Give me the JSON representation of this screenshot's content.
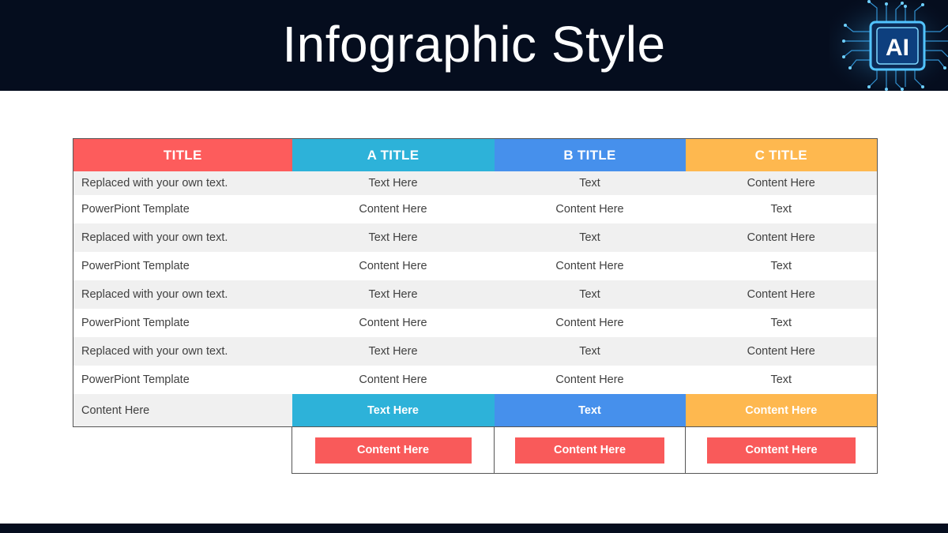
{
  "slide": {
    "title": "Infographic Style",
    "badge": "AI"
  },
  "colors": {
    "header_bg": "#050d1e",
    "title_col": "#fd5c5c",
    "a_col": "#2db2d9",
    "b_col": "#4690ec",
    "c_col": "#feb84f",
    "button": "#f95a5a",
    "row_alt": "#f0f0f0"
  },
  "table": {
    "headers": [
      "TITLE",
      "A TITLE",
      "B TITLE",
      "C TITLE"
    ],
    "rows": [
      [
        "Replaced with your own text.",
        "Text Here",
        "Text",
        "Content Here"
      ],
      [
        "PowerPiont Template",
        "Content Here",
        "Content Here",
        "Text"
      ],
      [
        "Replaced with your own text.",
        "Text Here",
        "Text",
        "Content Here"
      ],
      [
        "PowerPiont Template",
        "Content Here",
        "Content Here",
        "Text"
      ],
      [
        "Replaced with your own text.",
        "Text Here",
        "Text",
        "Content Here"
      ],
      [
        "PowerPiont Template",
        "Content Here",
        "Content Here",
        "Text"
      ],
      [
        "Replaced with your own text.",
        "Text Here",
        "Text",
        "Content Here"
      ],
      [
        "PowerPiont Template",
        "Content Here",
        "Content Here",
        "Text"
      ]
    ],
    "summary": [
      "Content Here",
      "Text Here",
      "Text",
      "Content Here"
    ],
    "buttons": [
      "Content Here",
      "Content Here",
      "Content Here"
    ]
  },
  "icons": {
    "chip": "ai-chip-icon"
  }
}
